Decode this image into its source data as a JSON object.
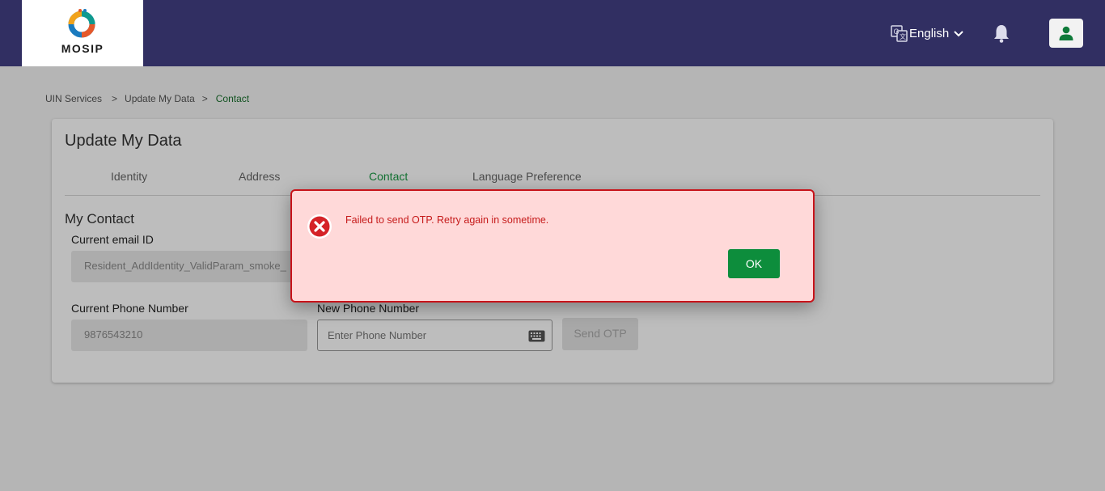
{
  "header": {
    "logo_text": "MOSIP",
    "language": "English",
    "brand_color": "#312f62"
  },
  "breadcrumb": {
    "items": [
      "UIN Services",
      "Update My Data",
      "Contact"
    ],
    "separator": ">"
  },
  "card": {
    "title": "Update My Data",
    "tabs": [
      {
        "label": "Identity",
        "active": false
      },
      {
        "label": "Address",
        "active": false
      },
      {
        "label": "Contact",
        "active": true
      },
      {
        "label": "Language Preference",
        "active": false
      }
    ],
    "section_title": "My Contact",
    "email": {
      "label": "Current email ID",
      "value": "Resident_AddIdentity_ValidParam_smoke_"
    },
    "phone": {
      "current_label": "Current Phone Number",
      "current_value": "9876543210",
      "new_label": "New Phone Number",
      "new_placeholder": "Enter Phone Number",
      "send_otp_label": "Send OTP"
    }
  },
  "dialog": {
    "message": "Failed to send OTP. Retry again in sometime.",
    "ok_label": "OK",
    "error_color": "#c8131a",
    "ok_color": "#0d8d3c"
  },
  "icons": [
    "translate-icon",
    "chevron-down-icon",
    "bell-icon",
    "user-icon",
    "keyboard-icon",
    "error-icon"
  ]
}
